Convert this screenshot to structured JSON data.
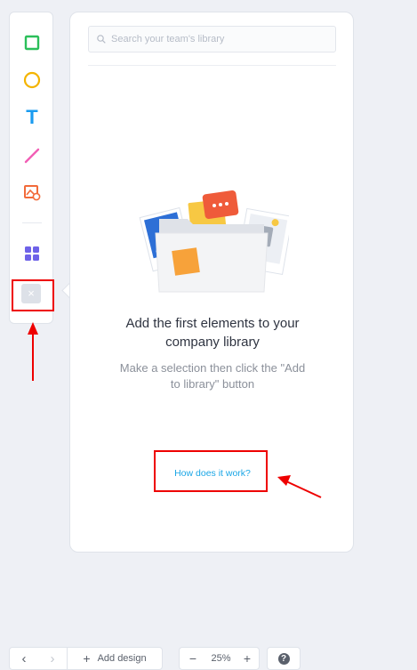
{
  "toolbar": {
    "tools": [
      {
        "name": "rectangle-tool",
        "color": "#2bbf5a"
      },
      {
        "name": "ellipse-tool",
        "color": "#f4b400"
      },
      {
        "name": "text-tool",
        "color": "#1a9bf0",
        "label": "T"
      },
      {
        "name": "line-tool",
        "color": "#f25fb5"
      },
      {
        "name": "image-tool",
        "color": "#f26b3a"
      },
      {
        "name": "library-tool",
        "color": "#6e62e8"
      }
    ],
    "close_symbol": "×"
  },
  "library": {
    "search_placeholder": "Search your team's library",
    "heading": "Add the first elements to your company library",
    "subtext": "Make a selection then click the \"Add to library\" button",
    "help_link": "How does it work?"
  },
  "bottom_bar": {
    "prev_symbol": "‹",
    "next_symbol": "›",
    "add_design_symbol": "+",
    "add_design_label": "Add design",
    "zoom_out_symbol": "−",
    "zoom_level": "25%",
    "zoom_in_symbol": "+",
    "help_symbol": "?"
  },
  "annotation_color": "#e00000"
}
